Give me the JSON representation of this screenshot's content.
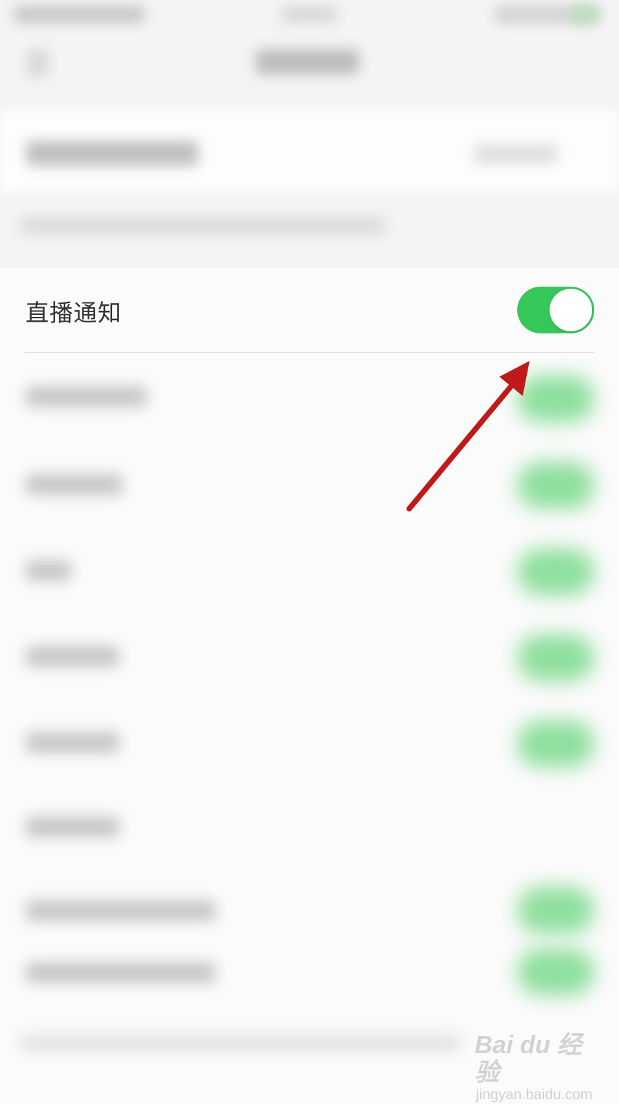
{
  "live_notify": {
    "label": "直播通知",
    "toggle_on": true
  },
  "colors": {
    "toggle_on": "#35c75a",
    "arrow": "#c0191c",
    "blurred_toggle": "#8fdf9f"
  },
  "blurred_rows": [
    {
      "toggle_on": true
    },
    {
      "toggle_on": true
    },
    {
      "toggle_on": true
    },
    {
      "toggle_on": true
    },
    {
      "toggle_on": true
    },
    {
      "toggle_on": false
    },
    {
      "toggle_on": true
    },
    {
      "toggle_on": true
    }
  ],
  "watermark": {
    "logo": "Bai du 经验",
    "url": "jingyan.baidu.com"
  }
}
